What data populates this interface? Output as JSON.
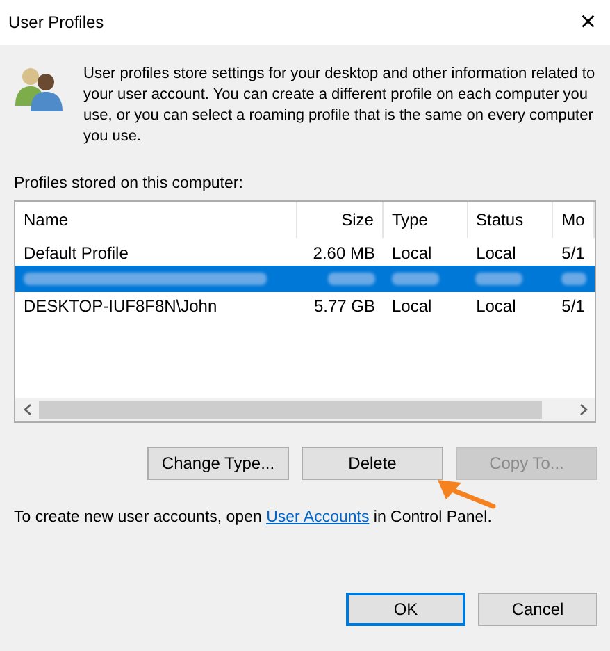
{
  "window": {
    "title": "User Profiles",
    "close": "×"
  },
  "intro": "User profiles store settings for your desktop and other information related to your user account. You can create a different profile on each computer you use, or you can select a roaming profile that is the same on every computer you use.",
  "list_label": "Profiles stored on this computer:",
  "table": {
    "columns": [
      {
        "label": "Name",
        "kind": "text"
      },
      {
        "label": "Size",
        "kind": "number"
      },
      {
        "label": "Type",
        "kind": "text"
      },
      {
        "label": "Status",
        "kind": "text"
      },
      {
        "label": "Mo",
        "kind": "text"
      }
    ],
    "rows": [
      {
        "selected": false,
        "redacted": false,
        "cells": [
          "Default Profile",
          "2.60 MB",
          "Local",
          "Local",
          "5/1"
        ]
      },
      {
        "selected": true,
        "redacted": true,
        "cells": []
      },
      {
        "selected": false,
        "redacted": false,
        "cells": [
          "DESKTOP-IUF8F8N\\John",
          "5.77 GB",
          "Local",
          "Local",
          "5/1"
        ]
      }
    ]
  },
  "profile_buttons": [
    {
      "label": "Change Type...",
      "disabled": false,
      "pointed": false
    },
    {
      "label": "Delete",
      "disabled": false,
      "pointed": true
    },
    {
      "label": "Copy To...",
      "disabled": true,
      "pointed": false
    }
  ],
  "footer": {
    "before": "To create new user accounts, open ",
    "link": "User Accounts",
    "after": " in Control Panel."
  },
  "dialog_buttons": [
    {
      "label": "OK",
      "default": true
    },
    {
      "label": "Cancel",
      "default": false
    }
  ]
}
